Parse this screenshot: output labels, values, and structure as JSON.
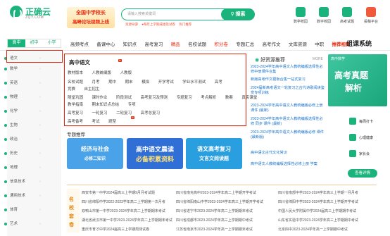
{
  "header": {
    "logo_text": "正确云",
    "logo_sub": "ZQY.COM",
    "promo_line1": "全国中学校长",
    "promo_line2": "高峰论坛视频上线",
    "search_placeholder": "请输入搜索关键词",
    "search_button": "搜索",
    "hot_tags": [
      "资源导游",
      "●每年上学期成绩及试卷",
      "热门推荐"
    ],
    "icons": [
      {
        "label": "数学校园",
        "icon": "school-icon"
      },
      {
        "label": "数字校园",
        "icon": "campus-icon"
      },
      {
        "label": "高考试题",
        "icon": "exam-icon"
      },
      {
        "label": "投稿平台",
        "icon": "upload-icon"
      }
    ]
  },
  "nav": {
    "grade_tabs": [
      "高中",
      "初中",
      "小学"
    ],
    "items": [
      "高频考点",
      "备课中心",
      "知识点",
      "高考复习",
      "精品",
      "名校试题",
      "积分卷",
      "专题汇总",
      "高考作文",
      "文库资源",
      "中职",
      "推荐视频"
    ],
    "right_title": "组课系统"
  },
  "sidebar": {
    "items": [
      "语文",
      "数学",
      "英语",
      "物理",
      "化学",
      "生物",
      "政治",
      "历史",
      "地理",
      "信息技术",
      "通用技术",
      "体育",
      "艺术"
    ]
  },
  "panel": {
    "title": "高中语文",
    "rows": [
      [
        "教材版本",
        "人教统编版",
        "人教版"
      ],
      [
        "名校试题",
        "月考",
        "期中",
        "期末",
        "模拟",
        "开学考试",
        "学业水平测试",
        "高考"
      ],
      [
        "竞赛",
        "自主招生"
      ],
      [
        "随堂巩固",
        "课时作业",
        "阶段测试",
        "高考复习及预测",
        "专题复习",
        "考点解析",
        "教案",
        "真实课堂"
      ],
      [
        "教学指南",
        "期末知识点总结",
        "专项"
      ],
      [
        "高考复习",
        "一轮复习",
        "二轮复习",
        "高考总复习"
      ],
      [
        "高考备考",
        "考试",
        "题型"
      ]
    ]
  },
  "news": {
    "title": "好资源推荐",
    "more": "MORE",
    "items": [
      "2023-2024学年高中语文人教统编版选择性必修中册课件合集",
      "新版高考作文模板合集一站式复习",
      "2024届新高考语文一轮复习之古代诗歌阅读鉴赏专项训练",
      "2023-2024学年高中语文人教统编版必修上册课件 (最新)",
      "2023-2024学年高中语文人教统编版选择性必修 同步 课件 (最新)",
      "2023-2024学年高中语文人教统编版必修 课件(最新版)",
      "高中语文古代文化常识",
      "高中语文人教统编版选择性必修上册 学案"
    ]
  },
  "promo_right": {
    "top_text": "高中数学",
    "line1": "高考真题",
    "line2": "解析"
  },
  "tools": [
    {
      "label": "每周打卡",
      "icon": "calendar-icon"
    },
    {
      "label": "心理健康",
      "icon": "heart-icon"
    },
    {
      "label": "家长会",
      "icon": "parents-icon"
    }
  ],
  "view_details": "查看详情",
  "topics": {
    "title": "专题推荐",
    "banners": [
      {
        "line1": "经济与社会",
        "line2": "必修二知识"
      },
      {
        "line1": "高中语文晨读",
        "line2": "必备积累资料"
      },
      {
        "line1": "语文高考复习",
        "line2": "文言文阅读题"
      }
    ]
  },
  "bottom": {
    "badge_chars": [
      "名",
      "校",
      "套",
      "卷"
    ],
    "col1": [
      "西安市第一中学2024届高三上学期9月月考试题",
      "四川省绵阳中学2022-2023学年高二上学期第一次月考",
      "双鸭山市第一中学2023-2024学年高二上学期期末考试",
      "湖北省武汉市第一中学2023-2024学年高二上学期期末考试",
      "重庆市育才中学2024届高三上学期周测试卷"
    ],
    "col2": [
      "四川省南充高中2023-2024学年高二上学期开学考试",
      "四川省绵阳南山中学2023-2024学年高三上学期开学考试",
      "四川省遂宁市2023-2024学年高二上学期期末考试",
      "四川省成都市2023-2024学年高三上学期期中考试",
      "江苏省南京市2023-2024学年高一上学期期末考试"
    ],
    "col3": [
      "四川省南部中学2023-2024学年高三上学期一月月考",
      "四川省绵阳中学2023-2024学年高三上学期开学考试",
      "中国人民大学附属中学2024届高三上学期期中考试",
      "山东省实验中学2023-2024学年高三上学期期中考试",
      "北京四中2023-2024学年高一上学期期中考试"
    ]
  }
}
